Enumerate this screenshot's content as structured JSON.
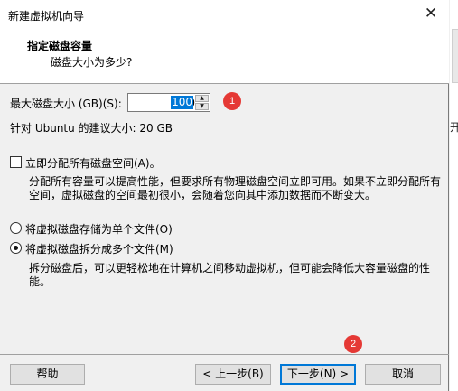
{
  "window": {
    "title": "新建虚拟机向导",
    "close_glyph": "✕"
  },
  "header": {
    "title": "指定磁盘容量",
    "subtitle": "磁盘大小为多少?"
  },
  "disk": {
    "size_label": "最大磁盘大小 (GB)(S):",
    "size_value": "100",
    "recommended": "针对 Ubuntu 的建议大小: 20 GB"
  },
  "allocate": {
    "label": "立即分配所有磁盘空间(A)。",
    "checked": false,
    "description": "分配所有容量可以提高性能，但要求所有物理磁盘空间立即可用。如果不立即分配所有空间，虚拟磁盘的空间最初很小，会随着您向其中添加数据而不断变大。"
  },
  "storage": {
    "options": [
      {
        "label": "将虚拟磁盘存储为单个文件(O)",
        "selected": false
      },
      {
        "label": "将虚拟磁盘拆分成多个文件(M)",
        "selected": true
      }
    ],
    "description": "拆分磁盘后，可以更轻松地在计算机之间移动虚拟机，但可能会降低大容量磁盘的性能。"
  },
  "badges": {
    "one": "1",
    "two": "2"
  },
  "buttons": {
    "help": "帮助",
    "back": "< 上一步(B)",
    "next": "下一步(N) >",
    "cancel": "取消"
  },
  "background": {
    "fragment": "开"
  },
  "colors": {
    "accent": "#0078d7",
    "badge": "#e53935"
  }
}
